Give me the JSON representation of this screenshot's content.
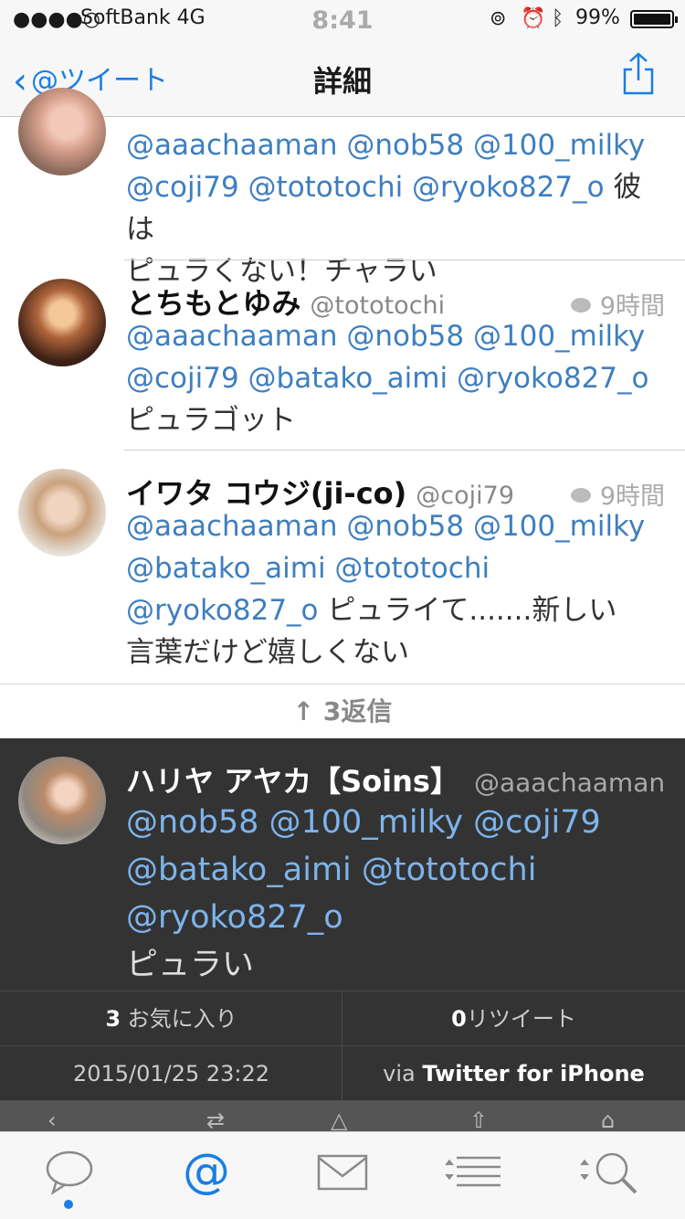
{
  "status_bar": {
    "signal": "●●●●○",
    "carrier": "SoftBank  4G",
    "time": "8:41",
    "battery": "99%"
  },
  "nav": {
    "back_label": "@ツイート",
    "title": "詳細",
    "share_icon": "share-icon"
  },
  "tweets": [
    {
      "name": "",
      "handle": "",
      "time": "",
      "mentions_line1": "@aaachaaman @nob58 @100_milky",
      "mentions_line2": "@coji79 @tototochi @ryoko827_o",
      "text_inline": "彼は",
      "text_line": "ピュラくない！チャラい"
    },
    {
      "name": "とちもとゆみ",
      "handle": "@tototochi",
      "time": "9時間",
      "mentions_line1": "@aaachaaman @nob58 @100_milky",
      "mentions_line2": "@coji79 @batako_aimi @ryoko827_o",
      "text_line": "ピュラゴット"
    },
    {
      "name": "イワタ コウジ(ji-co)",
      "handle": "@coji79",
      "time": "9時間",
      "mentions_line1": "@aaachaaman @nob58 @100_milky",
      "mentions_line2": "@batako_aimi @tototochi",
      "mentions_line3": "@ryoko827_o",
      "text_inline": "ピュライて.......新しい",
      "text_line": "言葉だけど嬉しくない"
    }
  ],
  "replies": {
    "label": "↑ 3返信"
  },
  "main_tweet": {
    "name": "ハリヤ アヤカ【Soins】",
    "handle": "@aaachaaman",
    "mentions_line1": "@nob58 @100_milky @coji79",
    "mentions_line2": "@batako_aimi @tototochi",
    "mentions_line3": "@ryoko827_o",
    "text_line": "ピュラい",
    "favorites_count": "3",
    "favorites_label": "お気に入り",
    "retweets_count": "0",
    "retweets_label": "リツイート",
    "timestamp": "2015/01/25 23:22",
    "via_prefix": "via",
    "client": "Twitter for iPhone"
  },
  "tabbar": {
    "items": [
      "speech-bubble-icon",
      "at-icon",
      "envelope-icon",
      "list-icon",
      "search-icon"
    ],
    "active_index": 1,
    "accent": "#1a7ee4"
  }
}
